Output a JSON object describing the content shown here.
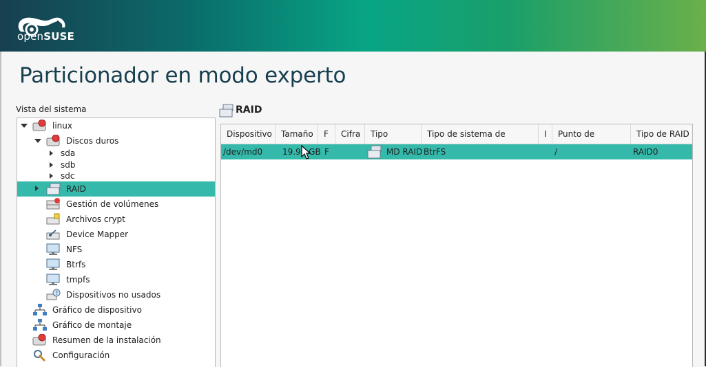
{
  "banner": {
    "logo_open": "open",
    "logo_suse": "SUSE"
  },
  "page": {
    "title": "Particionador en modo experto"
  },
  "tree": {
    "label": "Vista del sistema",
    "items": [
      {
        "label": "linux"
      },
      {
        "label": "Discos duros"
      },
      {
        "label": "sda"
      },
      {
        "label": "sdb"
      },
      {
        "label": "sdc"
      },
      {
        "label": "RAID"
      },
      {
        "label": "Gestión de volúmenes"
      },
      {
        "label": "Archivos crypt"
      },
      {
        "label": "Device Mapper"
      },
      {
        "label": "NFS"
      },
      {
        "label": "Btrfs"
      },
      {
        "label": "tmpfs"
      },
      {
        "label": "Dispositivos no usados"
      },
      {
        "label": "Gráfico de dispositivo"
      },
      {
        "label": "Gráfico de  montaje"
      },
      {
        "label": "Resumen de la instalación"
      },
      {
        "label": "Configuración"
      }
    ],
    "selected": "RAID"
  },
  "panel": {
    "title": "RAID",
    "columns": [
      "Dispositivo",
      "Tamaño",
      "F",
      "Cifra",
      "Tipo",
      "Tipo de sistema de archivos",
      "I",
      "Punto de montaje",
      "Tipo de RAID"
    ],
    "rows": [
      {
        "device": "/dev/md0",
        "size": "19.99 GB",
        "f": "F",
        "cifra": "",
        "tipo": "MD RAID",
        "fs": "BtrFS",
        "i": "",
        "mount": "/",
        "raid": "RAID0"
      }
    ]
  },
  "colors": {
    "accent": "#35b9ab",
    "title": "#173f4f"
  }
}
